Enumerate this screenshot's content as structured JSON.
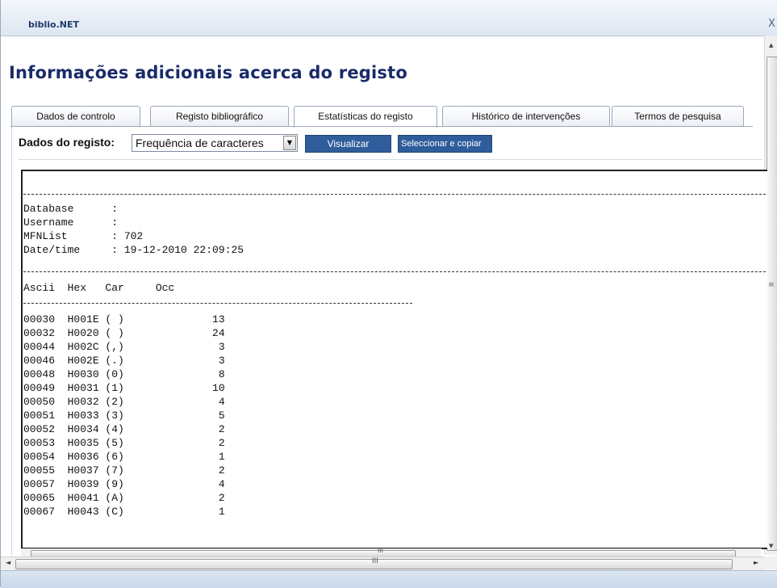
{
  "window": {
    "title": "biblio.NET",
    "close_glyph": "X"
  },
  "page_title": "Informações adicionais acerca do registo",
  "tabs": [
    {
      "label": "Dados de controlo"
    },
    {
      "label": "Registo bibliográfico"
    },
    {
      "label": "Estatísticas do registo",
      "active": true
    },
    {
      "label": "Histórico de intervenções"
    },
    {
      "label": "Termos de pesquisa"
    }
  ],
  "toolbar": {
    "label": "Dados do registo:",
    "select_value": "Frequência de caracteres",
    "visualizar_label": "Visualizar",
    "copy_label": "Seleccionar e copiar"
  },
  "report": {
    "header_lines": [
      "Database      :",
      "Username      :",
      "MFNList       : 702",
      "Date/time     : 19-12-2010 22:09:25"
    ],
    "columns_line": "Ascii  Hex   Car     Occ",
    "rows": [
      [
        "00030",
        "H001E",
        "( )",
        "13"
      ],
      [
        "00032",
        "H0020",
        "( )",
        "24"
      ],
      [
        "00044",
        "H002C",
        "(,)",
        "3"
      ],
      [
        "00046",
        "H002E",
        "(.)",
        "3"
      ],
      [
        "00048",
        "H0030",
        "(0)",
        "8"
      ],
      [
        "00049",
        "H0031",
        "(1)",
        "10"
      ],
      [
        "00050",
        "H0032",
        "(2)",
        "4"
      ],
      [
        "00051",
        "H0033",
        "(3)",
        "5"
      ],
      [
        "00052",
        "H0034",
        "(4)",
        "2"
      ],
      [
        "00053",
        "H0035",
        "(5)",
        "2"
      ],
      [
        "00054",
        "H0036",
        "(6)",
        "1"
      ],
      [
        "00055",
        "H0037",
        "(7)",
        "2"
      ],
      [
        "00057",
        "H0039",
        "(9)",
        "4"
      ],
      [
        "00065",
        "H0041",
        "(A)",
        "2"
      ],
      [
        "00067",
        "H0043",
        "(C)",
        "1"
      ]
    ]
  },
  "icons": {
    "dropdown": "chevron-down-icon",
    "scroll_up": "arrow-up-icon",
    "scroll_down": "arrow-down-icon",
    "scroll_left": "arrow-left-icon",
    "scroll_right": "arrow-right-icon"
  },
  "colors": {
    "title_text": "#1a2b69",
    "button_bg": "#2f5d9b",
    "titlebar_text": "#1d3b6c"
  }
}
